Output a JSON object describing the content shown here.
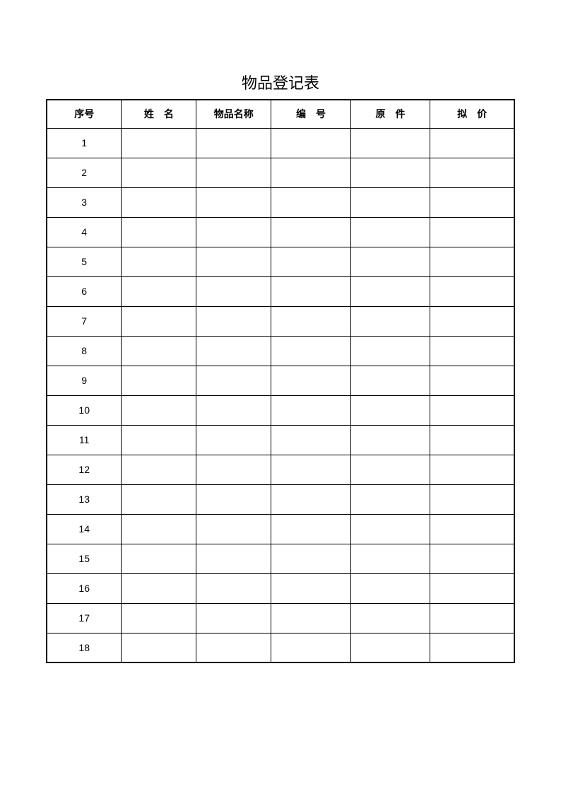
{
  "title": "物品登记表",
  "headers": {
    "index": "序号",
    "name": "姓　名",
    "item": "物品名称",
    "number": "编　号",
    "original": "原　件",
    "price": "拟　价"
  },
  "rows": [
    {
      "index": "1",
      "name": "",
      "item": "",
      "number": "",
      "original": "",
      "price": ""
    },
    {
      "index": "2",
      "name": "",
      "item": "",
      "number": "",
      "original": "",
      "price": ""
    },
    {
      "index": "3",
      "name": "",
      "item": "",
      "number": "",
      "original": "",
      "price": ""
    },
    {
      "index": "4",
      "name": "",
      "item": "",
      "number": "",
      "original": "",
      "price": ""
    },
    {
      "index": "5",
      "name": "",
      "item": "",
      "number": "",
      "original": "",
      "price": ""
    },
    {
      "index": "6",
      "name": "",
      "item": "",
      "number": "",
      "original": "",
      "price": ""
    },
    {
      "index": "7",
      "name": "",
      "item": "",
      "number": "",
      "original": "",
      "price": ""
    },
    {
      "index": "8",
      "name": "",
      "item": "",
      "number": "",
      "original": "",
      "price": ""
    },
    {
      "index": "9",
      "name": "",
      "item": "",
      "number": "",
      "original": "",
      "price": ""
    },
    {
      "index": "10",
      "name": "",
      "item": "",
      "number": "",
      "original": "",
      "price": ""
    },
    {
      "index": "11",
      "name": "",
      "item": "",
      "number": "",
      "original": "",
      "price": ""
    },
    {
      "index": "12",
      "name": "",
      "item": "",
      "number": "",
      "original": "",
      "price": ""
    },
    {
      "index": "13",
      "name": "",
      "item": "",
      "number": "",
      "original": "",
      "price": ""
    },
    {
      "index": "14",
      "name": "",
      "item": "",
      "number": "",
      "original": "",
      "price": ""
    },
    {
      "index": "15",
      "name": "",
      "item": "",
      "number": "",
      "original": "",
      "price": ""
    },
    {
      "index": "16",
      "name": "",
      "item": "",
      "number": "",
      "original": "",
      "price": ""
    },
    {
      "index": "17",
      "name": "",
      "item": "",
      "number": "",
      "original": "",
      "price": ""
    },
    {
      "index": "18",
      "name": "",
      "item": "",
      "number": "",
      "original": "",
      "price": ""
    }
  ]
}
